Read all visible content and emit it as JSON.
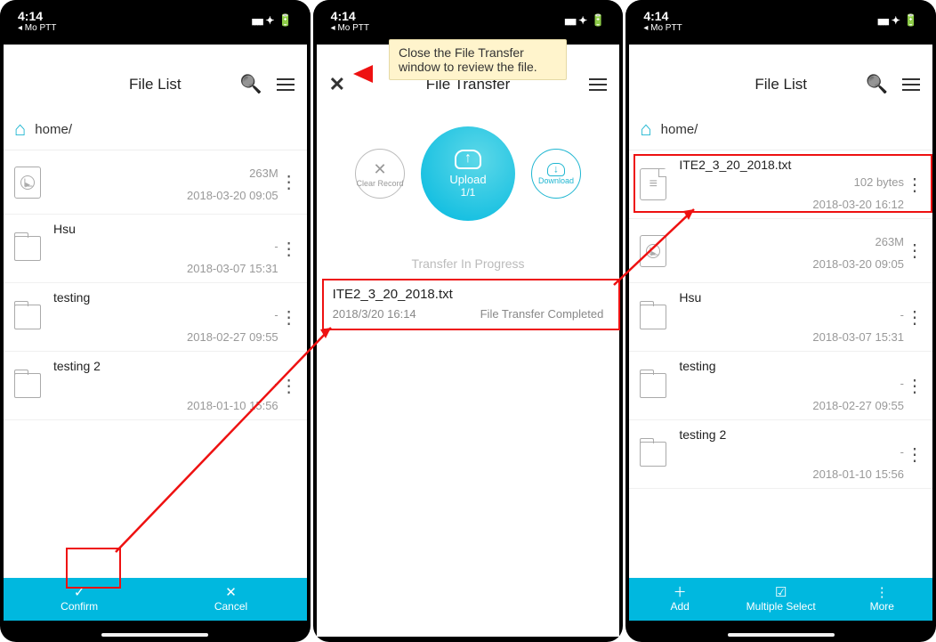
{
  "status": {
    "time": "4:14",
    "app": "◂ Mo PTT"
  },
  "screen1": {
    "title": "File List",
    "path": "home/",
    "items": [
      {
        "name": "",
        "size": "263M",
        "date": "2018-03-20 09:05",
        "type": "media"
      },
      {
        "name": "Hsu",
        "size": "-",
        "date": "2018-03-07 15:31",
        "type": "folder"
      },
      {
        "name": "testing",
        "size": "-",
        "date": "2018-02-27 09:55",
        "type": "folder"
      },
      {
        "name": "testing 2",
        "size": "-",
        "date": "2018-01-10 15:56",
        "type": "folder"
      }
    ],
    "actions": {
      "confirm": "Confirm",
      "cancel": "Cancel"
    }
  },
  "screen2": {
    "title": "File Transfer",
    "upload_label": "Upload",
    "upload_count": "1/1",
    "clear_label": "Clear Record",
    "download_label": "Download",
    "progress_label": "Transfer In Progress",
    "item": {
      "name": "ITE2_3_20_2018.txt",
      "date": "2018/3/20 16:14",
      "status": "File Transfer Completed"
    }
  },
  "screen3": {
    "title": "File List",
    "path": "home/",
    "items": [
      {
        "name": "ITE2_3_20_2018.txt",
        "size": "102 bytes",
        "date": "2018-03-20 16:12",
        "type": "text"
      },
      {
        "name": "",
        "size": "263M",
        "date": "2018-03-20 09:05",
        "type": "media"
      },
      {
        "name": "Hsu",
        "size": "-",
        "date": "2018-03-07 15:31",
        "type": "folder"
      },
      {
        "name": "testing",
        "size": "-",
        "date": "2018-02-27 09:55",
        "type": "folder"
      },
      {
        "name": "testing 2",
        "size": "-",
        "date": "2018-01-10 15:56",
        "type": "folder"
      }
    ],
    "actions": {
      "add": "Add",
      "multi": "Multiple Select",
      "more": "More"
    }
  },
  "annotations": {
    "callout": "Close the File Transfer window to review the file."
  }
}
